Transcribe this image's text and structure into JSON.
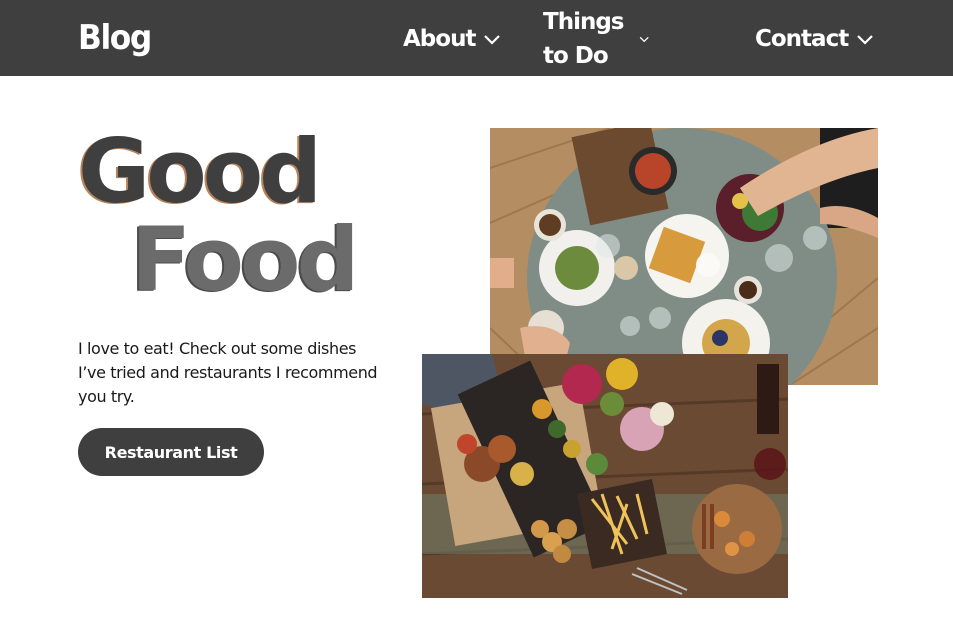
{
  "header": {
    "brand": "Blog",
    "nav": [
      {
        "label": "About",
        "icon": "chevron-down-icon"
      },
      {
        "label": "Things to Do",
        "icon": "chevron-down-icon"
      },
      {
        "label": "Contact",
        "icon": "chevron-down-icon"
      }
    ]
  },
  "hero": {
    "title_line_1": "Good",
    "title_line_2": "Food",
    "intro": "I love to eat! Check out some dishes I’ve tried and restaurants I recommend you try.",
    "cta_label": "Restaurant List"
  },
  "photos": {
    "top_alt": "Overhead view of a round table with waffles, breakfast plates, drinks and hands reaching for food",
    "bottom_alt": "Overhead view of a wooden table with grilled meats, fries, bread rolls, fruit, flowers and wine"
  },
  "colors": {
    "header_bg": "#3f3f3f",
    "title_dark": "#3f3f3f",
    "title_light": "#6b6b6b",
    "button_bg": "#3f3f3f",
    "page_bg": "#ffffff"
  }
}
